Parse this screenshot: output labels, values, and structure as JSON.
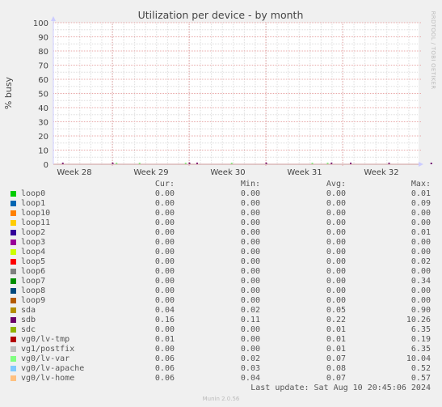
{
  "chart_data": {
    "type": "line",
    "title": "Utilization per device - by month",
    "ylabel": "% busy",
    "xlabel": "",
    "ylim": [
      0,
      100
    ],
    "yticks": [
      0,
      10,
      20,
      30,
      40,
      50,
      60,
      70,
      80,
      90,
      100
    ],
    "xticks": [
      "Week 28",
      "Week 29",
      "Week 30",
      "Week 31",
      "Week 32"
    ],
    "grid": true,
    "watermark": "RRDTOOL / TOBI OETIKER",
    "columns": [
      "Cur:",
      "Min:",
      "Avg:",
      "Max:"
    ],
    "series": [
      {
        "name": "loop0",
        "color": "#00cc00",
        "cur": "0.00",
        "min": "0.00",
        "avg": "0.00",
        "max": "0.01"
      },
      {
        "name": "loop1",
        "color": "#0066b3",
        "cur": "0.00",
        "min": "0.00",
        "avg": "0.00",
        "max": "0.09"
      },
      {
        "name": "loop10",
        "color": "#ff8000",
        "cur": "0.00",
        "min": "0.00",
        "avg": "0.00",
        "max": "0.00"
      },
      {
        "name": "loop11",
        "color": "#ffcc00",
        "cur": "0.00",
        "min": "0.00",
        "avg": "0.00",
        "max": "0.00"
      },
      {
        "name": "loop2",
        "color": "#330099",
        "cur": "0.00",
        "min": "0.00",
        "avg": "0.00",
        "max": "0.01"
      },
      {
        "name": "loop3",
        "color": "#990099",
        "cur": "0.00",
        "min": "0.00",
        "avg": "0.00",
        "max": "0.00"
      },
      {
        "name": "loop4",
        "color": "#ccff00",
        "cur": "0.00",
        "min": "0.00",
        "avg": "0.00",
        "max": "0.00"
      },
      {
        "name": "loop5",
        "color": "#ff0000",
        "cur": "0.00",
        "min": "0.00",
        "avg": "0.00",
        "max": "0.02"
      },
      {
        "name": "loop6",
        "color": "#808080",
        "cur": "0.00",
        "min": "0.00",
        "avg": "0.00",
        "max": "0.00"
      },
      {
        "name": "loop7",
        "color": "#008f00",
        "cur": "0.00",
        "min": "0.00",
        "avg": "0.00",
        "max": "0.34"
      },
      {
        "name": "loop8",
        "color": "#00487d",
        "cur": "0.00",
        "min": "0.00",
        "avg": "0.00",
        "max": "0.00"
      },
      {
        "name": "loop9",
        "color": "#b35a00",
        "cur": "0.00",
        "min": "0.00",
        "avg": "0.00",
        "max": "0.00"
      },
      {
        "name": "sda",
        "color": "#b38f00",
        "cur": "0.04",
        "min": "0.02",
        "avg": "0.05",
        "max": "0.90"
      },
      {
        "name": "sdb",
        "color": "#6b006b",
        "cur": "0.16",
        "min": "0.11",
        "avg": "0.22",
        "max": "10.26"
      },
      {
        "name": "sdc",
        "color": "#8fb300",
        "cur": "0.00",
        "min": "0.00",
        "avg": "0.01",
        "max": "6.35"
      },
      {
        "name": "vg0/lv-tmp",
        "color": "#b30000",
        "cur": "0.01",
        "min": "0.00",
        "avg": "0.01",
        "max": "0.19"
      },
      {
        "name": "vg1/postfix",
        "color": "#bebebe",
        "cur": "0.00",
        "min": "0.00",
        "avg": "0.01",
        "max": "6.35"
      },
      {
        "name": "vg0/lv-var",
        "color": "#80ff80",
        "cur": "0.06",
        "min": "0.02",
        "avg": "0.07",
        "max": "10.04"
      },
      {
        "name": "vg0/lv-apache",
        "color": "#80c9ff",
        "cur": "0.06",
        "min": "0.03",
        "avg": "0.08",
        "max": "0.52"
      },
      {
        "name": "vg0/lv-home",
        "color": "#ffc080",
        "cur": "0.06",
        "min": "0.04",
        "avg": "0.07",
        "max": "0.57"
      }
    ],
    "spikes": [
      {
        "week_pos": 0.35,
        "series": "sdb",
        "value": 0.5
      },
      {
        "week_pos": 1.0,
        "series": "sdb",
        "value": 0.6
      },
      {
        "week_pos": 1.05,
        "series": "vg0/lv-var",
        "value": 0.6
      },
      {
        "week_pos": 1.35,
        "series": "vg0/lv-var",
        "value": 0.5
      },
      {
        "week_pos": 1.95,
        "series": "vg0/lv-var",
        "value": 0.5
      },
      {
        "week_pos": 2.0,
        "series": "sdb",
        "value": 0.5
      },
      {
        "week_pos": 2.1,
        "series": "sdb",
        "value": 0.4
      },
      {
        "week_pos": 2.55,
        "series": "vg0/lv-var",
        "value": 0.8
      },
      {
        "week_pos": 3.0,
        "series": "sdb",
        "value": 0.4
      },
      {
        "week_pos": 3.6,
        "series": "vg0/lv-var",
        "value": 0.4
      },
      {
        "week_pos": 3.8,
        "series": "vg0/lv-var",
        "value": 0.8
      },
      {
        "week_pos": 3.85,
        "series": "sdb",
        "value": 0.5
      },
      {
        "week_pos": 4.1,
        "series": "sdb",
        "value": 0.5
      },
      {
        "week_pos": 4.6,
        "series": "sdb",
        "value": 0.4
      },
      {
        "week_pos": 5.15,
        "series": "sdb",
        "value": 0.4
      }
    ]
  },
  "footer": {
    "last_update": "Last update: Sat Aug 10 20:45:06 2024",
    "version": "Munin 2.0.56"
  }
}
